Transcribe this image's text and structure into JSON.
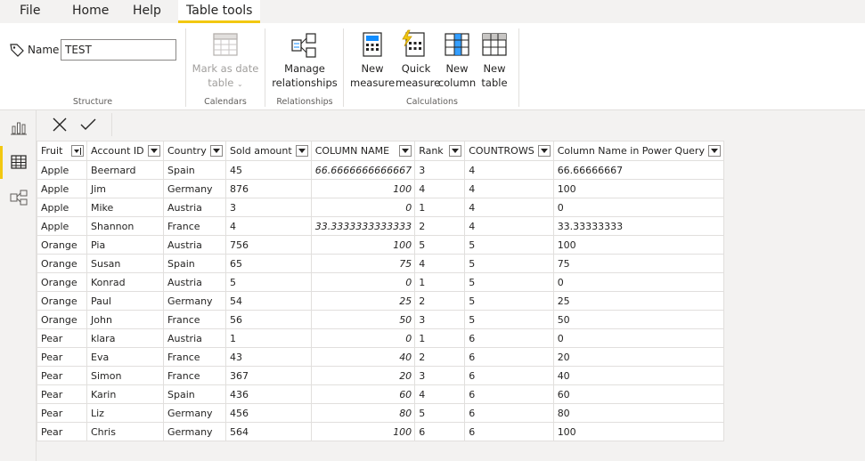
{
  "menu": {
    "file": "File",
    "home": "Home",
    "help": "Help",
    "table_tools": "Table tools"
  },
  "ribbon": {
    "structure": {
      "name_label": "Name",
      "name_value": "TEST",
      "group_label": "Structure"
    },
    "calendars": {
      "mark_as_date_table_line1": "Mark as date",
      "mark_as_date_table_line2": "table",
      "group_label": "Calendars"
    },
    "relationships": {
      "manage_line1": "Manage",
      "manage_line2": "relationships",
      "group_label": "Relationships"
    },
    "calculations": {
      "new_measure_line1": "New",
      "new_measure_line2": "measure",
      "quick_measure_line1": "Quick",
      "quick_measure_line2": "measure",
      "new_column_line1": "New",
      "new_column_line2": "column",
      "new_table_line1": "New",
      "new_table_line2": "table",
      "group_label": "Calculations"
    }
  },
  "left_nav": {
    "icons": [
      "report-view-icon",
      "data-view-icon",
      "model-view-icon"
    ],
    "accent_color": "#f2c811"
  },
  "table": {
    "columns": [
      "Fruit",
      "Account ID",
      "Country",
      "Sold amount",
      "COLUMN NAME",
      "Rank",
      "COUNTROWS",
      "Column Name in Power Query"
    ],
    "rows": [
      [
        "Apple",
        "Beernard",
        "Spain",
        "45",
        "66.6666666666667",
        "3",
        "4",
        "66.66666667"
      ],
      [
        "Apple",
        "Jim",
        "Germany",
        "876",
        "100",
        "4",
        "4",
        "100"
      ],
      [
        "Apple",
        "Mike",
        "Austria",
        "3",
        "0",
        "1",
        "4",
        "0"
      ],
      [
        "Apple",
        "Shannon",
        "France",
        "4",
        "33.3333333333333",
        "2",
        "4",
        "33.33333333"
      ],
      [
        "Orange",
        "Pia",
        "Austria",
        "756",
        "100",
        "5",
        "5",
        "100"
      ],
      [
        "Orange",
        "Susan",
        "Spain",
        "65",
        "75",
        "4",
        "5",
        "75"
      ],
      [
        "Orange",
        "Konrad",
        "Austria",
        "5",
        "0",
        "1",
        "5",
        "0"
      ],
      [
        "Orange",
        "Paul",
        "Germany",
        "54",
        "25",
        "2",
        "5",
        "25"
      ],
      [
        "Orange",
        "John",
        "France",
        "56",
        "50",
        "3",
        "5",
        "50"
      ],
      [
        "Pear",
        "klara",
        "Austria",
        "1",
        "0",
        "1",
        "6",
        "0"
      ],
      [
        "Pear",
        "Eva",
        "France",
        "43",
        "40",
        "2",
        "6",
        "20"
      ],
      [
        "Pear",
        "Simon",
        "France",
        "367",
        "20",
        "3",
        "6",
        "40"
      ],
      [
        "Pear",
        "Karin",
        "Spain",
        "436",
        "60",
        "4",
        "6",
        "60"
      ],
      [
        "Pear",
        "Liz",
        "Germany",
        "456",
        "80",
        "5",
        "6",
        "80"
      ],
      [
        "Pear",
        "Chris",
        "Germany",
        "564",
        "100",
        "6",
        "6",
        "100"
      ]
    ]
  }
}
